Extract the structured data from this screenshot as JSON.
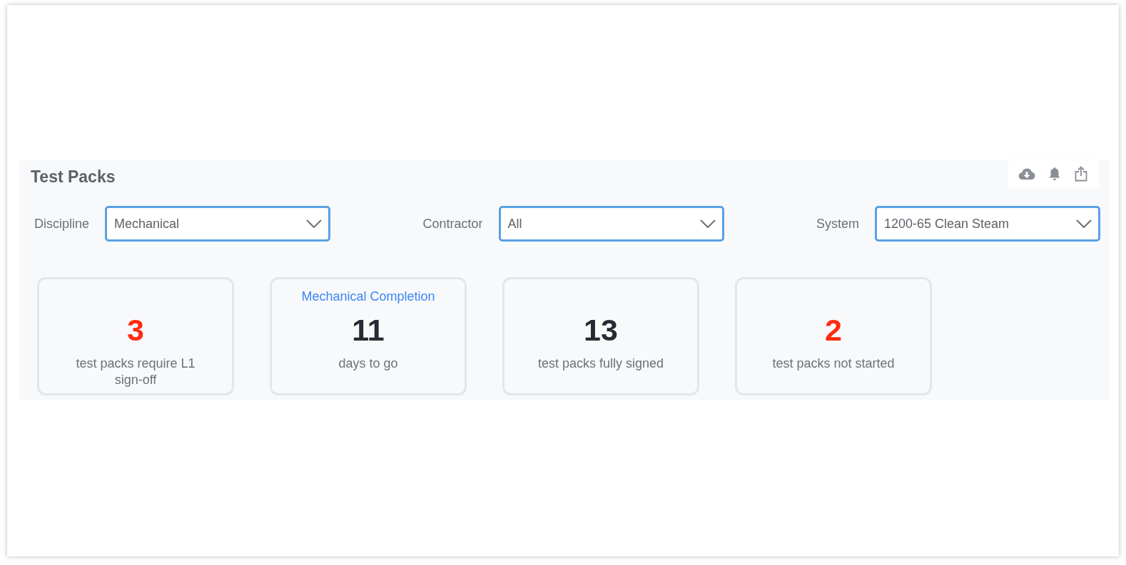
{
  "panel": {
    "title": "Test Packs"
  },
  "toolbar": [
    {
      "kind": "download"
    },
    {
      "kind": "bell"
    },
    {
      "kind": "share"
    }
  ],
  "filters": [
    {
      "label": "Discipline",
      "value": "Mechanical"
    },
    {
      "label": "Contractor",
      "value": "All"
    },
    {
      "label": "System",
      "value": "1200-65 Clean Steam"
    }
  ],
  "cards": [
    {
      "value": "3",
      "alert": true,
      "description": "test packs require L1 sign-off"
    },
    {
      "caption": "Mechanical Completion",
      "value": "11",
      "alert": false,
      "description": "days to go"
    },
    {
      "value": "13",
      "alert": false,
      "description": "test packs fully signed"
    },
    {
      "value": "2",
      "alert": true,
      "description": "test packs not started"
    }
  ]
}
